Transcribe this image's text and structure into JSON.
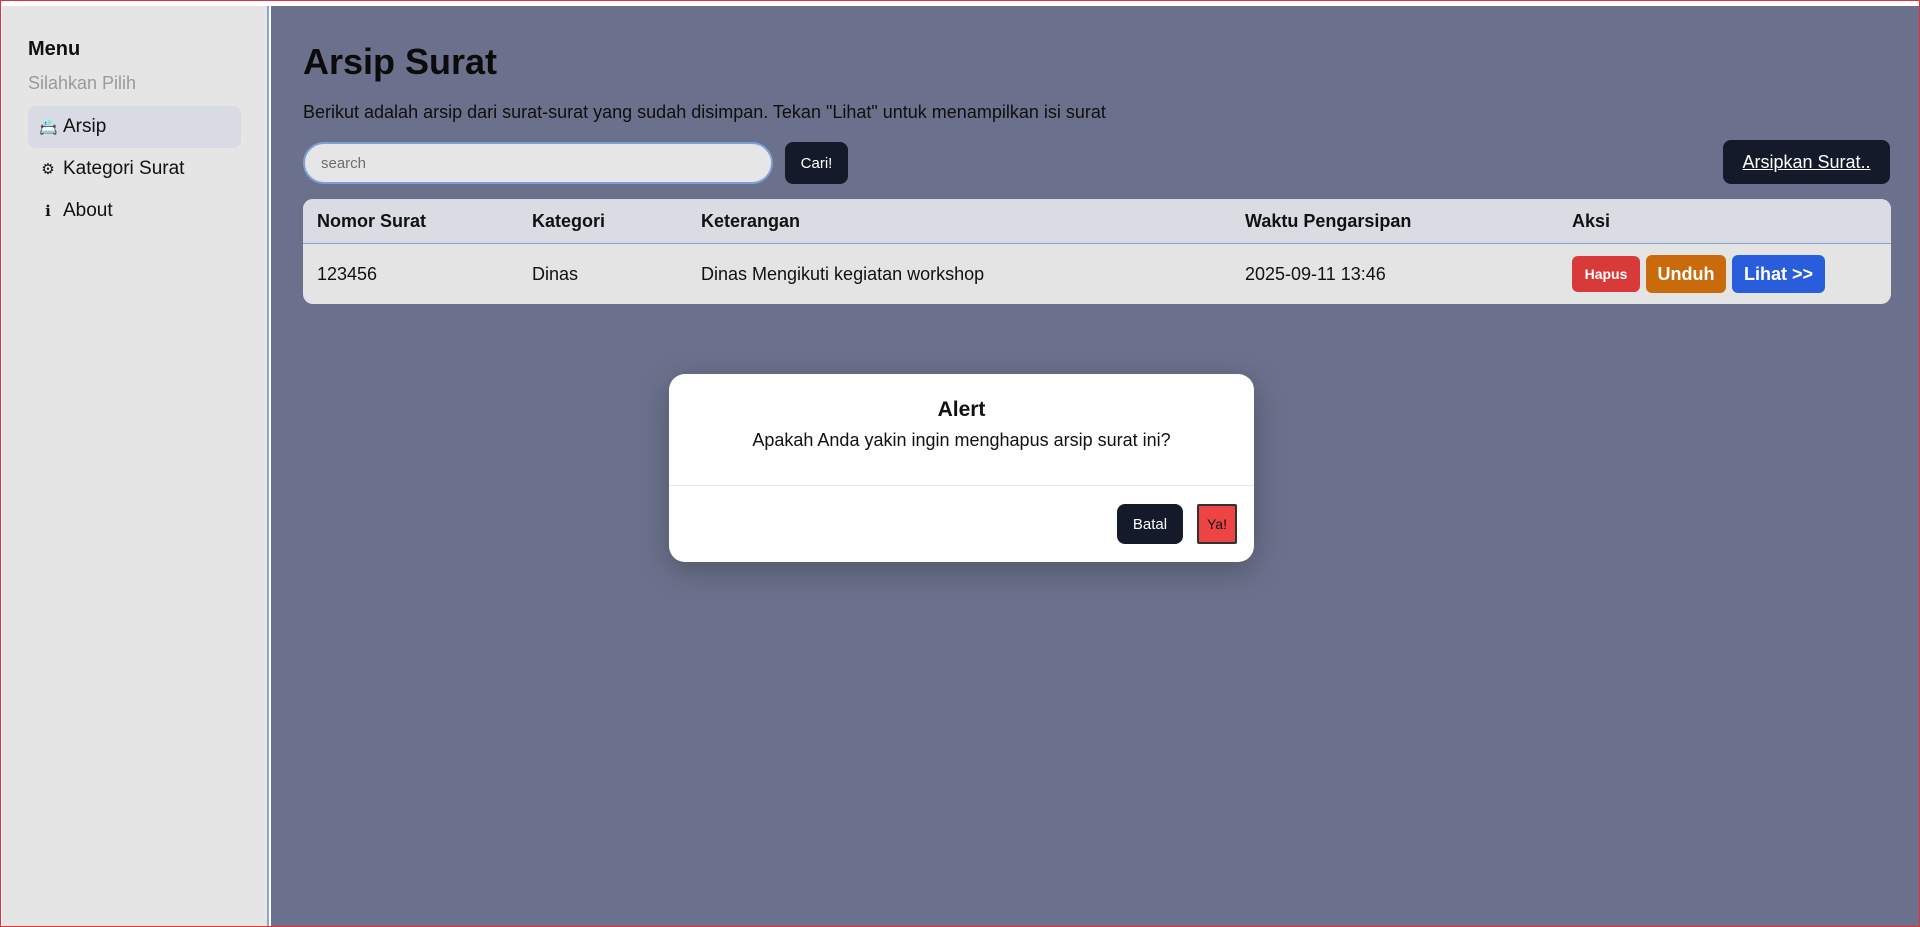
{
  "sidebar": {
    "title": "Menu",
    "subtitle": "Silahkan Pilih",
    "items": [
      {
        "icon": "📇",
        "label": "Arsip",
        "active": true
      },
      {
        "icon": "⚙",
        "label": "Kategori Surat",
        "active": false
      },
      {
        "icon": "ℹ",
        "label": "About",
        "active": false
      }
    ]
  },
  "main": {
    "title": "Arsip Surat",
    "description": "Berikut adalah arsip dari surat-surat yang sudah disimpan. Tekan \"Lihat\" untuk menampilkan isi surat",
    "search": {
      "placeholder": "search",
      "value": "",
      "button_label": "Cari!"
    },
    "archive_button_label": "Arsipkan Surat..",
    "table": {
      "headers": [
        "Nomor Surat",
        "Kategori",
        "Keterangan",
        "Waktu Pengarsipan",
        "Aksi"
      ],
      "rows": [
        {
          "nomor": "123456",
          "kategori": "Dinas",
          "keterangan": "Dinas Mengikuti kegiatan workshop",
          "waktu": "2025-09-11 13:46",
          "actions": {
            "hapus": "Hapus",
            "unduh": "Unduh",
            "lihat": "Lihat >>"
          }
        }
      ]
    }
  },
  "modal": {
    "title": "Alert",
    "message": "Apakah Anda yakin ingin menghapus arsip surat ini?",
    "cancel_label": "Batal",
    "confirm_label": "Ya!"
  },
  "colors": {
    "sidebar_bg": "#e5e5e5",
    "main_bg": "#6b718c",
    "dark_button": "#141a2a",
    "danger": "#d83a3a",
    "warning": "#c96b0b",
    "primary": "#2a5ddc"
  }
}
